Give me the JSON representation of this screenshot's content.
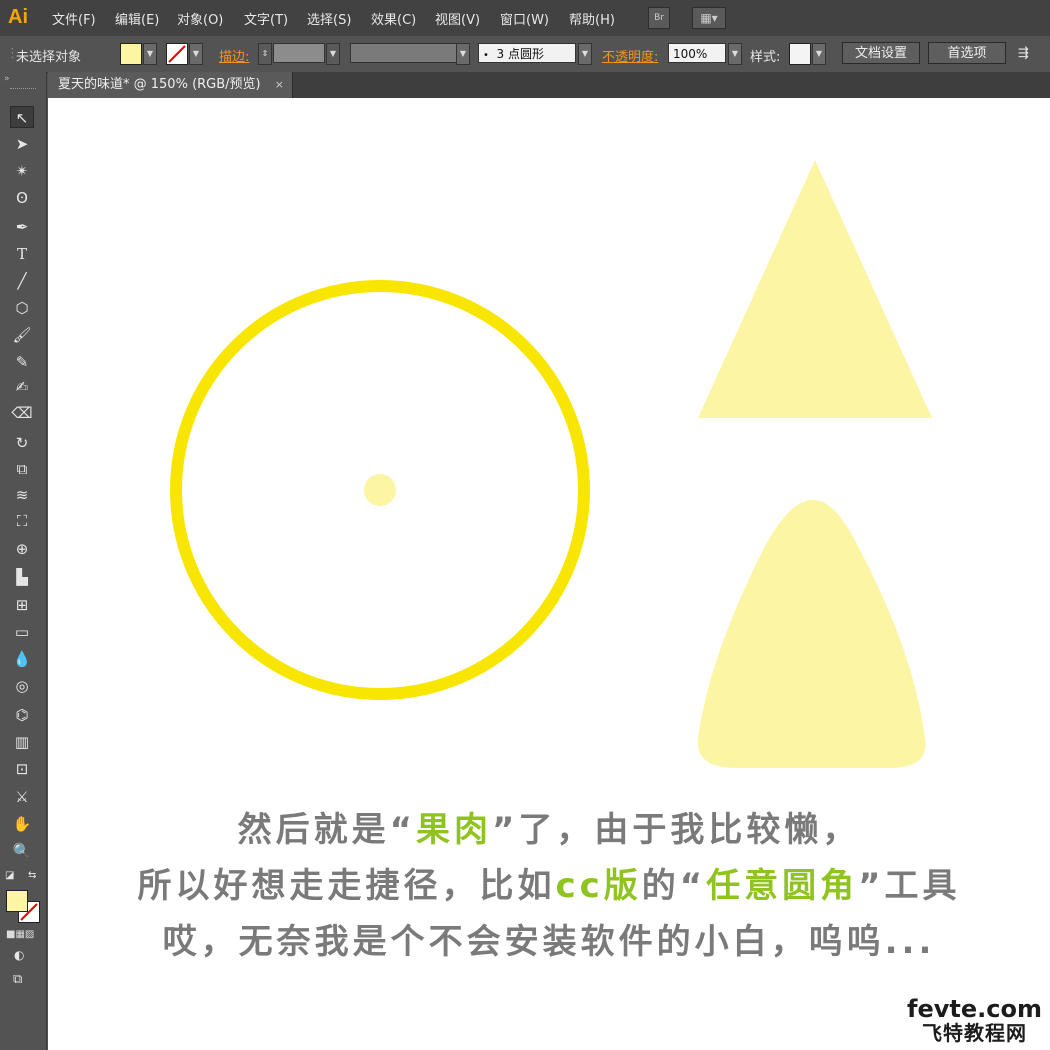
{
  "app": {
    "logo": "Ai"
  },
  "menu": {
    "items": [
      "文件(F)",
      "编辑(E)",
      "对象(O)",
      "文字(T)",
      "选择(S)",
      "效果(C)",
      "视图(V)",
      "窗口(W)",
      "帮助(H)"
    ],
    "bridge_label": "Br"
  },
  "control": {
    "selection_status": "未选择对象",
    "stroke_label": "描边:",
    "brush_value": "3 点圆形",
    "opacity_label": "不透明度:",
    "opacity_value": "100%",
    "style_label": "样式:",
    "doc_setup": "文档设置",
    "prefs": "首选项"
  },
  "tab": {
    "title": "夏天的味道* @ 150% (RGB/预览)",
    "close": "×"
  },
  "colors": {
    "fill": "#fcf5a4",
    "circle_stroke": "#f8e600",
    "accent": "#8fc31f",
    "caption": "#7a7a7a"
  },
  "caption": {
    "line1_a": "然后就是“",
    "line1_hl": "果肉",
    "line1_b": "”了，由于我比较懒，",
    "line2_a": "所以好想走走捷径，比如",
    "line2_hl1": "cc版",
    "line2_b": "的“",
    "line2_hl2": "任意圆角",
    "line2_c": "”工具",
    "line3": "哎，无奈我是个不会安装软件的小白，呜呜..."
  },
  "watermark": {
    "line1": "fevte.com",
    "line2": "飞特教程网"
  }
}
